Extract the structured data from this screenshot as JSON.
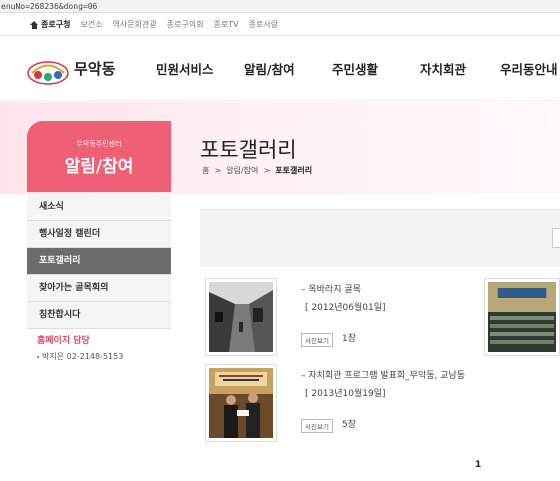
{
  "browser": {
    "url_fragment": "enuNo=268236&dong=06"
  },
  "utility_nav": {
    "home_label": "종로구청",
    "links": [
      "보건소",
      "역사문화관광",
      "종로구의회",
      "종로TV",
      "종로사랑"
    ]
  },
  "header": {
    "dong_name": "무악동",
    "menu": [
      "민원서비스",
      "알림/참여",
      "주민생활",
      "자치회관",
      "우리동안내"
    ]
  },
  "sidebar": {
    "subtitle": "무악동주민센터",
    "title": "알림/참여",
    "items": [
      {
        "label": "새소식",
        "active": false
      },
      {
        "label": "행사일정 캘린더",
        "active": false
      },
      {
        "label": "포토갤러리",
        "active": true
      },
      {
        "label": "찾아가는 골목회의",
        "active": false
      },
      {
        "label": "칭찬합시다",
        "active": false
      }
    ],
    "contact": {
      "label": "홈페이지 담당",
      "phone": "박지은 02-2148-5153"
    }
  },
  "content": {
    "title": "포토갤러리",
    "breadcrumb": [
      "홈",
      "알림/참여",
      "포토갤러리"
    ],
    "breadcrumb_sep": ">",
    "gallery": [
      {
        "title": "옥바라지 골목",
        "date": "[ 2012년06월01일]",
        "tag": "사진보기",
        "count": "1장",
        "thumb": "bw-alley"
      },
      {
        "title": "자치회관 프로그램 발표회_무악동, 교남동",
        "date": "[ 2013년10월19일]",
        "tag": "사진보기",
        "count": "5장",
        "thumb": "award-ceremony"
      },
      {
        "title": "",
        "date": "",
        "tag": "",
        "count": "",
        "thumb": "group-photo"
      }
    ],
    "pagination": {
      "current": "1"
    }
  },
  "colors": {
    "accent": "#ef5f75",
    "active_menu": "#6c6c6c",
    "hero_bg": "#fde4ea"
  }
}
